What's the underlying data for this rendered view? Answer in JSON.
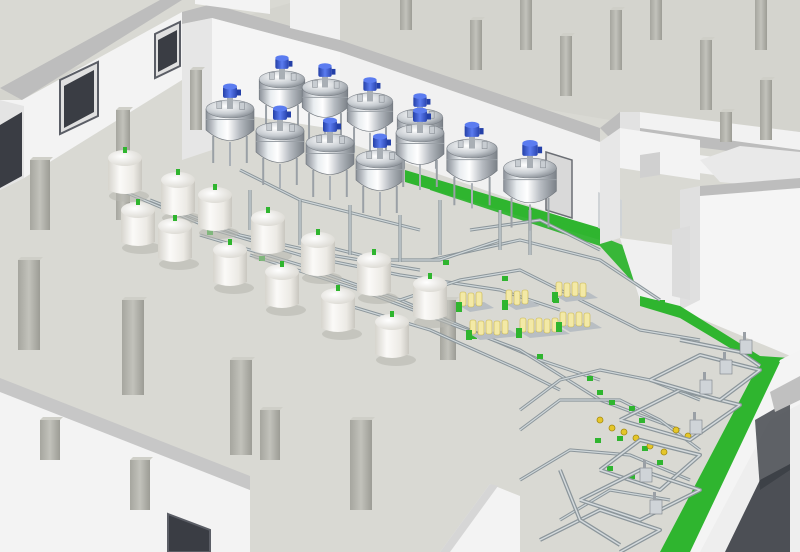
{
  "scene": {
    "description_free": true,
    "colors": {
      "floor": "#d8d8d2",
      "floor_shadow": "#c9c9c3",
      "wall": "#f4f4f4",
      "wall_shade": "#e2e2e2",
      "wall_top": "#b9b9b9",
      "column": "#b5b5ae",
      "column_shade": "#9e9e97",
      "steel_light": "#eef0f2",
      "steel_mid": "#b9bec4",
      "steel_dark": "#7e848b",
      "motor_blue": "#3f63d8",
      "motor_blue_dark": "#2440a8",
      "tank_white": "#f2f1ee",
      "tank_shade": "#d8d6cf",
      "pipe": "#9aa3a8",
      "pipe_light": "#c9d1d4",
      "green_strip": "#2fb52f",
      "green_strip_dark": "#1f8a1f",
      "valve_yellow": "#e5c62a",
      "glass_dark": "#3a3d44"
    }
  }
}
